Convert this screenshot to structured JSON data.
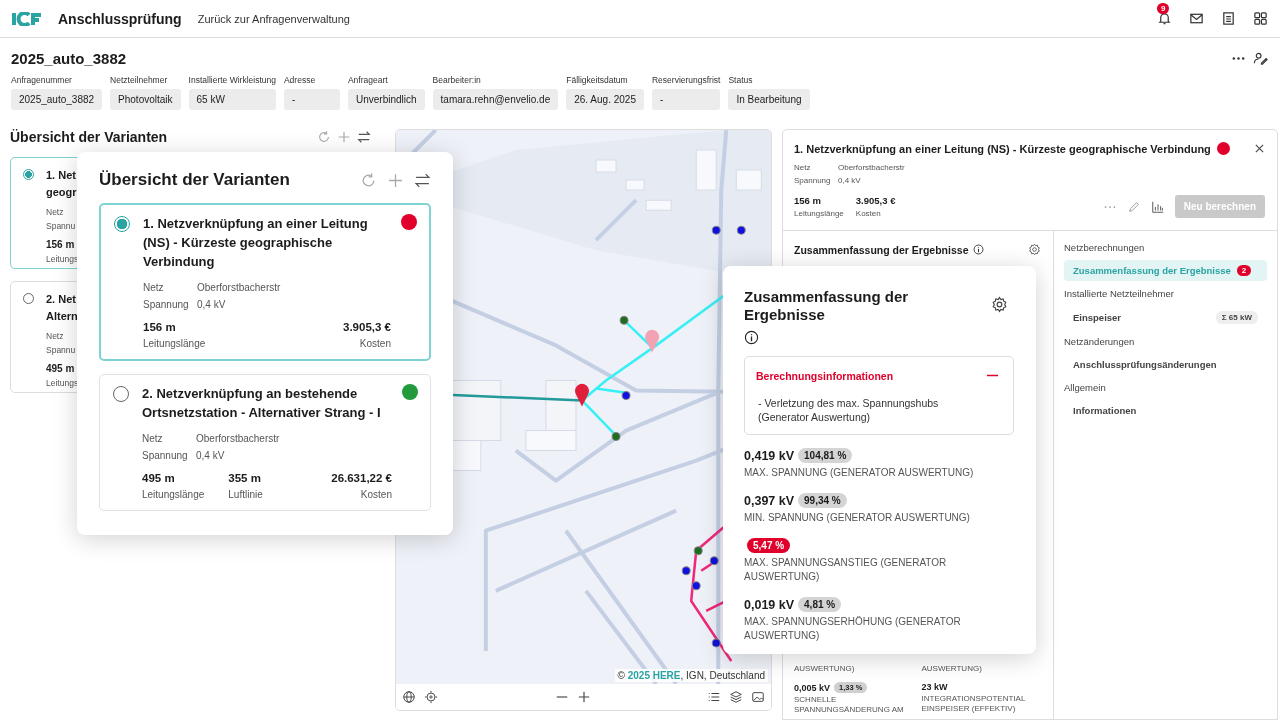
{
  "app": {
    "title": "Anschlussprüfung",
    "back_link": "Zurück zur Anfragenverwaltung",
    "notification_count": "9"
  },
  "request": {
    "title": "2025_auto_3882",
    "fields": [
      {
        "label": "Anfragenummer",
        "value": "2025_auto_3882"
      },
      {
        "label": "Netzteilnehmer",
        "value": "Photovoltaik"
      },
      {
        "label": "Installierte Wirkleistung",
        "value": "65 kW"
      },
      {
        "label": "Adresse",
        "value": "-"
      },
      {
        "label": "Anfrageart",
        "value": "Unverbindlich"
      },
      {
        "label": "Bearbeiter:in",
        "value": "tamara.rehn@envelio.de"
      },
      {
        "label": "Fälligkeitsdatum",
        "value": "26. Aug. 2025"
      },
      {
        "label": "Reservierungsfrist",
        "value": "-"
      },
      {
        "label": "Status",
        "value": "In Bearbeitung"
      }
    ]
  },
  "variants_panel": {
    "title": "Übersicht der Varianten",
    "cards": [
      {
        "selected": true,
        "title_lines": [
          "1. Net",
          "geogr"
        ],
        "netz_label": "Netz",
        "spannung_label": "Spannu",
        "length": "156 m",
        "length_label": "Leitungs"
      },
      {
        "selected": false,
        "title_lines": [
          "2. Net",
          "Altern"
        ],
        "netz_label": "Netz",
        "spannung_label": "Spannu",
        "length": "495 m",
        "length_label": "Leitungs"
      }
    ]
  },
  "variants_popup": {
    "title": "Übersicht der Varianten",
    "cards": [
      {
        "selected": true,
        "color": "#e0002b",
        "title": "1. Netzverknüpfung an einer Leitung (NS) - Kürzeste geographische Verbindung",
        "netz_label": "Netz",
        "netz": "Oberforstbacherstr",
        "spannung_label": "Spannung",
        "spannung": "0,4 kV",
        "metrics": [
          {
            "value": "156 m",
            "label": "Leitungslänge",
            "kind": "left"
          },
          {
            "value": "3.905,3 €",
            "label": "Kosten",
            "kind": "right"
          }
        ]
      },
      {
        "selected": false,
        "color": "#239a3b",
        "title": "2. Netzverknüpfung an bestehende Ortsnetzstation - Alternativer Strang - I",
        "netz_label": "Netz",
        "netz": "Oberforstbacherstr",
        "spannung_label": "Spannung",
        "spannung": "0,4 kV",
        "metrics": [
          {
            "value": "495 m",
            "label": "Leitungslänge",
            "kind": "left"
          },
          {
            "value": "355 m",
            "label": "Luftlinie",
            "kind": "left"
          },
          {
            "value": "26.631,22 €",
            "label": "Kosten",
            "kind": "right"
          }
        ]
      }
    ]
  },
  "map": {
    "attribution_prefix": "©",
    "attribution_link": "2025 HERE",
    "attribution_suffix": ", IGN, Deutschland"
  },
  "detail": {
    "title": "1. Netzverknüpfung an einer Leitung (NS) - Kürzeste geographische Verbindung",
    "color": "#e0002b",
    "netz_label": "Netz",
    "netz": "Oberforstbacherstr",
    "spannung_label": "Spannung",
    "spannung": "0,4 kV",
    "metrics": [
      {
        "value": "156 m",
        "label": "Leitungslänge"
      },
      {
        "value": "3.905,3 €",
        "label": "Kosten"
      }
    ],
    "recalc_button": {
      "label": "Neu berechnen",
      "disabled": true
    },
    "summary": {
      "title": "Zusammenfassung der Ergebnisse",
      "rows": [
        {
          "cells": [
            {
              "label": "AUSWERTUNG)"
            },
            {
              "label": "AUSWERTUNG)"
            }
          ]
        },
        {
          "cells": [
            {
              "value": "0,005 kV",
              "percent": "1,33 %",
              "label": "SCHNELLE SPANNUNGSÄNDERUNG AM"
            },
            {
              "value": "23 kW",
              "label": "INTEGRATIONSPOTENTIAL EINSPEISER (EFFEKTIV)"
            }
          ]
        }
      ]
    },
    "nav": [
      {
        "kind": "heading",
        "label": "Netzberechnungen"
      },
      {
        "kind": "item",
        "label": "Zusammenfassung der Ergebnisse",
        "selected": true,
        "badge": "2"
      },
      {
        "kind": "heading",
        "label": "Installierte Netzteilnehmer"
      },
      {
        "kind": "item",
        "label": "Einspeiser",
        "selected": false,
        "tag": "Σ 65 kW"
      },
      {
        "kind": "heading",
        "label": "Netzänderungen"
      },
      {
        "kind": "item",
        "label": "Anschlussprüfungsänderungen",
        "selected": false
      },
      {
        "kind": "heading",
        "label": "Allgemein"
      },
      {
        "kind": "item",
        "label": "Informationen",
        "selected": false
      }
    ]
  },
  "summary_popup": {
    "title": "Zusammenfassung der Ergebnisse",
    "info": {
      "title": "Berechnungsinformationen",
      "expanded": true,
      "text": "- Verletzung des max. Spannungshubs (Generator Auswertung)"
    },
    "metrics": [
      {
        "value": "0,419 kV",
        "percent": "104,81 %",
        "alert": false,
        "label": "MAX. SPANNUNG (GENERATOR AUSWERTUNG)"
      },
      {
        "value": "0,397 kV",
        "percent": "99,34 %",
        "alert": false,
        "label": "MIN. SPANNUNG (GENERATOR AUSWERTUNG)"
      },
      {
        "percent": "5,47 %",
        "alert": true,
        "label": "MAX. SPANNUNGSANSTIEG (GENERATOR AUSWERTUNG)"
      },
      {
        "value": "0,019 kV",
        "percent": "4,81 %",
        "alert": false,
        "label": "MAX. SPANNUNGSERHÖHUNG (GENERATOR AUSWERTUNG)"
      }
    ]
  }
}
